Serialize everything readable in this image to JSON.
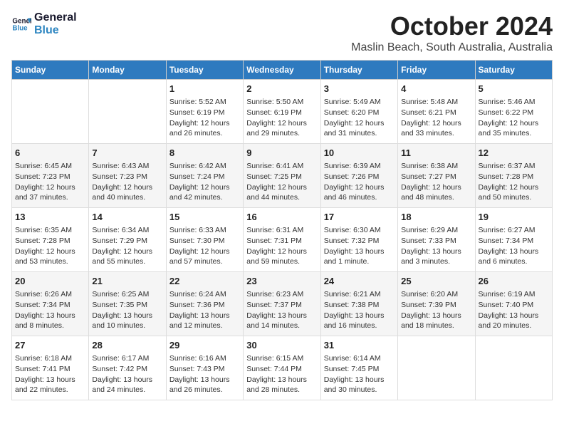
{
  "logo": {
    "line1": "General",
    "line2": "Blue"
  },
  "title": "October 2024",
  "subtitle": "Maslin Beach, South Australia, Australia",
  "days_of_week": [
    "Sunday",
    "Monday",
    "Tuesday",
    "Wednesday",
    "Thursday",
    "Friday",
    "Saturday"
  ],
  "weeks": [
    [
      {
        "day": "",
        "info": ""
      },
      {
        "day": "",
        "info": ""
      },
      {
        "day": "1",
        "info": "Sunrise: 5:52 AM\nSunset: 6:19 PM\nDaylight: 12 hours\nand 26 minutes."
      },
      {
        "day": "2",
        "info": "Sunrise: 5:50 AM\nSunset: 6:19 PM\nDaylight: 12 hours\nand 29 minutes."
      },
      {
        "day": "3",
        "info": "Sunrise: 5:49 AM\nSunset: 6:20 PM\nDaylight: 12 hours\nand 31 minutes."
      },
      {
        "day": "4",
        "info": "Sunrise: 5:48 AM\nSunset: 6:21 PM\nDaylight: 12 hours\nand 33 minutes."
      },
      {
        "day": "5",
        "info": "Sunrise: 5:46 AM\nSunset: 6:22 PM\nDaylight: 12 hours\nand 35 minutes."
      }
    ],
    [
      {
        "day": "6",
        "info": "Sunrise: 6:45 AM\nSunset: 7:23 PM\nDaylight: 12 hours\nand 37 minutes."
      },
      {
        "day": "7",
        "info": "Sunrise: 6:43 AM\nSunset: 7:23 PM\nDaylight: 12 hours\nand 40 minutes."
      },
      {
        "day": "8",
        "info": "Sunrise: 6:42 AM\nSunset: 7:24 PM\nDaylight: 12 hours\nand 42 minutes."
      },
      {
        "day": "9",
        "info": "Sunrise: 6:41 AM\nSunset: 7:25 PM\nDaylight: 12 hours\nand 44 minutes."
      },
      {
        "day": "10",
        "info": "Sunrise: 6:39 AM\nSunset: 7:26 PM\nDaylight: 12 hours\nand 46 minutes."
      },
      {
        "day": "11",
        "info": "Sunrise: 6:38 AM\nSunset: 7:27 PM\nDaylight: 12 hours\nand 48 minutes."
      },
      {
        "day": "12",
        "info": "Sunrise: 6:37 AM\nSunset: 7:28 PM\nDaylight: 12 hours\nand 50 minutes."
      }
    ],
    [
      {
        "day": "13",
        "info": "Sunrise: 6:35 AM\nSunset: 7:28 PM\nDaylight: 12 hours\nand 53 minutes."
      },
      {
        "day": "14",
        "info": "Sunrise: 6:34 AM\nSunset: 7:29 PM\nDaylight: 12 hours\nand 55 minutes."
      },
      {
        "day": "15",
        "info": "Sunrise: 6:33 AM\nSunset: 7:30 PM\nDaylight: 12 hours\nand 57 minutes."
      },
      {
        "day": "16",
        "info": "Sunrise: 6:31 AM\nSunset: 7:31 PM\nDaylight: 12 hours\nand 59 minutes."
      },
      {
        "day": "17",
        "info": "Sunrise: 6:30 AM\nSunset: 7:32 PM\nDaylight: 13 hours\nand 1 minute."
      },
      {
        "day": "18",
        "info": "Sunrise: 6:29 AM\nSunset: 7:33 PM\nDaylight: 13 hours\nand 3 minutes."
      },
      {
        "day": "19",
        "info": "Sunrise: 6:27 AM\nSunset: 7:34 PM\nDaylight: 13 hours\nand 6 minutes."
      }
    ],
    [
      {
        "day": "20",
        "info": "Sunrise: 6:26 AM\nSunset: 7:34 PM\nDaylight: 13 hours\nand 8 minutes."
      },
      {
        "day": "21",
        "info": "Sunrise: 6:25 AM\nSunset: 7:35 PM\nDaylight: 13 hours\nand 10 minutes."
      },
      {
        "day": "22",
        "info": "Sunrise: 6:24 AM\nSunset: 7:36 PM\nDaylight: 13 hours\nand 12 minutes."
      },
      {
        "day": "23",
        "info": "Sunrise: 6:23 AM\nSunset: 7:37 PM\nDaylight: 13 hours\nand 14 minutes."
      },
      {
        "day": "24",
        "info": "Sunrise: 6:21 AM\nSunset: 7:38 PM\nDaylight: 13 hours\nand 16 minutes."
      },
      {
        "day": "25",
        "info": "Sunrise: 6:20 AM\nSunset: 7:39 PM\nDaylight: 13 hours\nand 18 minutes."
      },
      {
        "day": "26",
        "info": "Sunrise: 6:19 AM\nSunset: 7:40 PM\nDaylight: 13 hours\nand 20 minutes."
      }
    ],
    [
      {
        "day": "27",
        "info": "Sunrise: 6:18 AM\nSunset: 7:41 PM\nDaylight: 13 hours\nand 22 minutes."
      },
      {
        "day": "28",
        "info": "Sunrise: 6:17 AM\nSunset: 7:42 PM\nDaylight: 13 hours\nand 24 minutes."
      },
      {
        "day": "29",
        "info": "Sunrise: 6:16 AM\nSunset: 7:43 PM\nDaylight: 13 hours\nand 26 minutes."
      },
      {
        "day": "30",
        "info": "Sunrise: 6:15 AM\nSunset: 7:44 PM\nDaylight: 13 hours\nand 28 minutes."
      },
      {
        "day": "31",
        "info": "Sunrise: 6:14 AM\nSunset: 7:45 PM\nDaylight: 13 hours\nand 30 minutes."
      },
      {
        "day": "",
        "info": ""
      },
      {
        "day": "",
        "info": ""
      }
    ]
  ]
}
